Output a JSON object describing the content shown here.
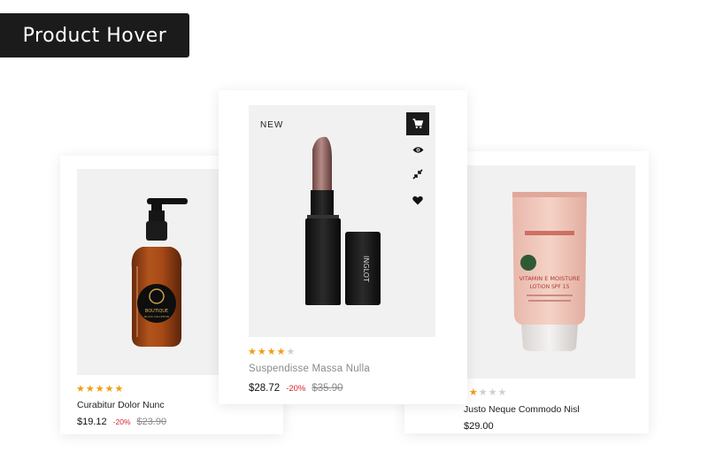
{
  "banner": {
    "title": "Product Hover"
  },
  "products": [
    {
      "name": "Curabitur Dolor Nunc",
      "price": "$19.12",
      "discount": "-20%",
      "old_price": "$23.90",
      "rating": 5,
      "image_icon": "amber-soap-bottle",
      "label_text": "BOUTIQUE",
      "label_subtext": "BLACK COLLETION"
    },
    {
      "name": "Suspendisse Massa Nulla",
      "price": "$28.72",
      "discount": "-20%",
      "old_price": "$35.90",
      "rating": 4,
      "badge": "NEW",
      "image_icon": "lipstick",
      "brand_text": "INGLOT",
      "actions": [
        "cart-icon",
        "eye-icon",
        "compare-icon",
        "heart-icon"
      ]
    },
    {
      "name": "Justo Neque Commodo Nisl",
      "price": "$29.00",
      "rating": 2,
      "image_icon": "cream-tube",
      "tube_line1": "VITAMIN E MOISTURE",
      "tube_line2": "LOTION SPF 15"
    }
  ],
  "colors": {
    "accent": "#f39c12",
    "discount": "#d9232e",
    "dark": "#1b1b1b",
    "image_bg": "#f1f1f1"
  }
}
